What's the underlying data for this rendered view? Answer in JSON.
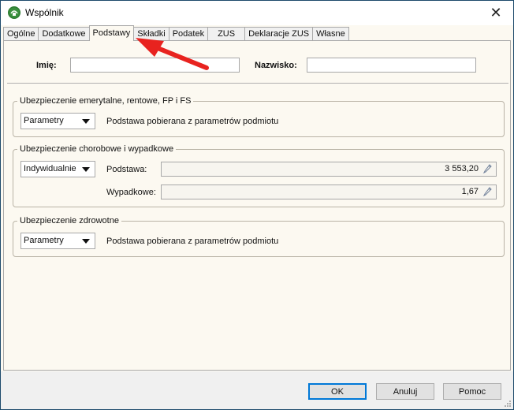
{
  "window": {
    "title": "Wspólnik",
    "icon": "app-logo-icon",
    "close_glyph": "✕"
  },
  "tabs": [
    {
      "label": "Ogólne"
    },
    {
      "label": "Dodatkowe"
    },
    {
      "label": "Podstawy"
    },
    {
      "label": "Składki"
    },
    {
      "label": "Podatek"
    },
    {
      "label": "ZUS"
    },
    {
      "label": "Deklaracje ZUS"
    },
    {
      "label": "Własne"
    }
  ],
  "active_tab": "Podstawy",
  "person": {
    "first_name_label": "Imię:",
    "first_name_value": "",
    "last_name_label": "Nazwisko:",
    "last_name_value": ""
  },
  "pension_group": {
    "title": "Ubezpieczenie emerytalne, rentowe, FP i FS",
    "mode": "Parametry",
    "description": "Podstawa pobierana z parametrów podmiotu"
  },
  "sickness_group": {
    "title": "Ubezpieczenie chorobowe i wypadkowe",
    "mode": "Indywidualnie",
    "base_label": "Podstawa:",
    "base_value": "3 553,20",
    "accident_label": "Wypadkowe:",
    "accident_value": "1,67"
  },
  "health_group": {
    "title": "Ubezpieczenie zdrowotne",
    "mode": "Parametry",
    "description": "Podstawa pobierana z parametrów podmiotu"
  },
  "buttons": {
    "ok": "OK",
    "cancel": "Anuluj",
    "help": "Pomoc"
  },
  "colors": {
    "annotation_arrow": "#e8231f",
    "panel_bg": "#fcf9f1",
    "default_button_border": "#0078d7"
  }
}
